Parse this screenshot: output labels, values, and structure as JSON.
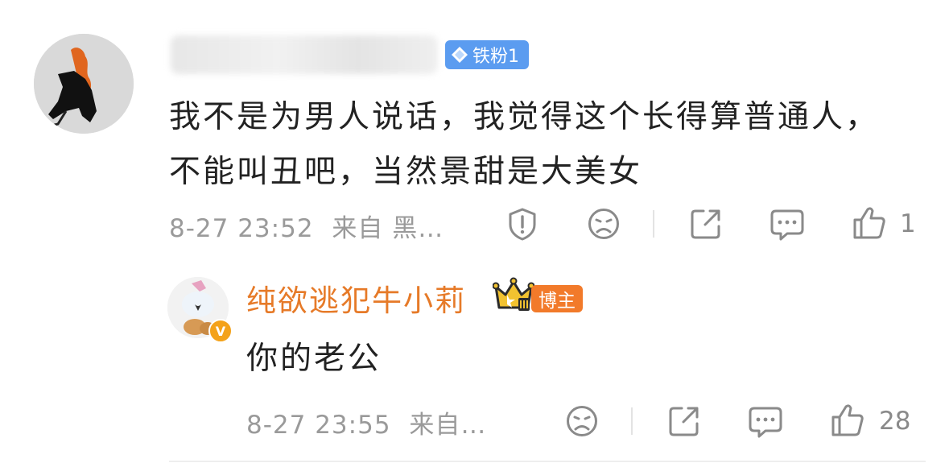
{
  "comment": {
    "badge_label": "铁粉1",
    "text": "我不是为男人说话，我觉得这个长得算普通人，不能叫丑吧，当然景甜是大美女",
    "time": "8-27 23:52",
    "source": "来自 黑…",
    "like_count": "1"
  },
  "reply": {
    "username": "纯欲逃犯牛小莉",
    "badge_label": "博主",
    "verified_mark": "V",
    "text": "你的老公",
    "time": "8-27 23:55",
    "source": "来自…",
    "like_count": "28"
  },
  "colors": {
    "reply_name": "#e67a28",
    "fan_badge": "#5b9cf0",
    "blogger_badge": "#f27a2a",
    "meta_text": "#9a9a9a"
  }
}
